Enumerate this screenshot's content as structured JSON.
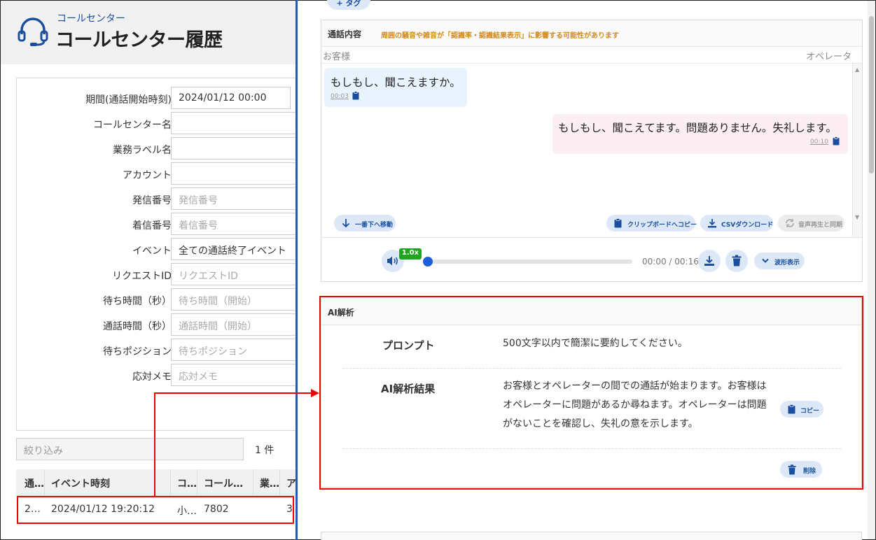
{
  "header": {
    "subtitle": "コールセンター",
    "title": "コールセンター履歴",
    "icon": "headset-icon"
  },
  "filters": [
    {
      "label": "期間(通話開始時刻)",
      "value": "2024/01/12 00:00",
      "placeholder": ""
    },
    {
      "label": "コールセンター名",
      "value": "",
      "placeholder": ""
    },
    {
      "label": "業務ラベル名",
      "value": "",
      "placeholder": ""
    },
    {
      "label": "アカウント",
      "value": "",
      "placeholder": ""
    },
    {
      "label": "発信番号",
      "value": "",
      "placeholder": "発信番号"
    },
    {
      "label": "着信番号",
      "value": "",
      "placeholder": "着信番号"
    },
    {
      "label": "イベント",
      "value": "全ての通話終了イベント",
      "placeholder": ""
    },
    {
      "label": "リクエストID",
      "value": "",
      "placeholder": "リクエストID"
    },
    {
      "label": "待ち時間（秒）",
      "value": "",
      "placeholder": "待ち時間（開始）"
    },
    {
      "label": "通話時間（秒）",
      "value": "",
      "placeholder": "通話時間（開始）"
    },
    {
      "label": "待ちポジション",
      "value": "",
      "placeholder": "待ちポジション"
    },
    {
      "label": "応対メモ",
      "value": "",
      "placeholder": "応対メモ"
    }
  ],
  "narrow": {
    "placeholder": "絞り込み",
    "count": "1 件"
  },
  "table": {
    "headers": [
      "通…",
      "イベント時刻",
      "コ…",
      "コール…",
      "業…",
      "ア"
    ],
    "row": [
      "2…",
      "2024/01/12 19:20:12",
      "小…",
      "7802",
      "",
      "3"
    ]
  },
  "tag_button": "+ タグ",
  "call": {
    "title": "通話内容",
    "warning": "周囲の騒音や雑音が「認識率・認識結果表示」に影響する可能性があります",
    "customer_label": "お客様",
    "operator_label": "オペレータ",
    "messages": [
      {
        "speaker": "customer",
        "text": "もしもし、聞こえますか。",
        "time": "00:03"
      },
      {
        "speaker": "operator",
        "text": "もしもし、聞こえてます。問題ありません。失礼します。",
        "time": "00:10"
      }
    ],
    "actions": {
      "scroll_bottom": "一番下へ移動",
      "clipboard": "クリップボードへコピー",
      "csv": "CSVダウンロード",
      "sync": "音声再生と同期"
    },
    "player": {
      "speed": "1.0x",
      "time": "00:00 / 00:16",
      "waveform": "波形表示",
      "progress": 0
    }
  },
  "ai": {
    "title": "AI解析",
    "prompt_label": "プロンプト",
    "prompt_value": "500文字以内で簡潔に要約してください。",
    "result_label": "AI解析結果",
    "result_lines": [
      "お客様とオペレーターの間での通話が始まります。お客様は",
      "オペレーターに問題があるか尋ねます。オペレーターは問題",
      "がないことを確認し、失礼の意を示します。"
    ],
    "copy": "コピー",
    "delete": "削除"
  },
  "colors": {
    "accent": "#1d5fb8",
    "highlight": "#e00000",
    "warning": "#d4891a"
  }
}
